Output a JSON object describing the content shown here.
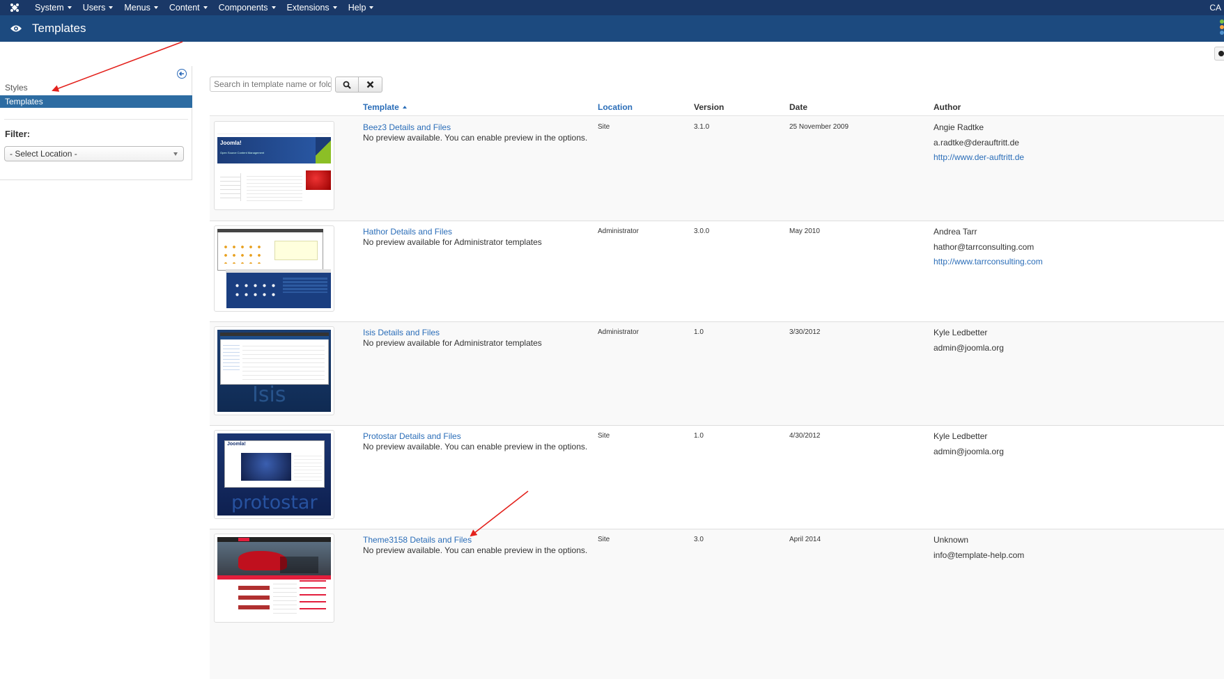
{
  "navbar": {
    "menus": [
      "System",
      "Users",
      "Menus",
      "Content",
      "Components",
      "Extensions",
      "Help"
    ],
    "right_text": "CA"
  },
  "header": {
    "title": "Templates"
  },
  "sidebar": {
    "items": [
      {
        "label": "Styles",
        "active": false
      },
      {
        "label": "Templates",
        "active": true
      }
    ],
    "filter_label": "Filter:",
    "location_select": "- Select Location -"
  },
  "search": {
    "placeholder": "Search in template name or folder"
  },
  "table": {
    "headers": {
      "template": "Template",
      "location": "Location",
      "version": "Version",
      "date": "Date",
      "author": "Author"
    },
    "rows": [
      {
        "name": "Beez3 Details and Files",
        "desc": "No preview available. You can enable preview in the options.",
        "location": "Site",
        "version": "3.1.0",
        "date": "25 November 2009",
        "author": "Angie Radtke",
        "email": "a.radtke@derauftritt.de",
        "url": "http://www.der-auftritt.de",
        "thumb": "beez3"
      },
      {
        "name": "Hathor Details and Files",
        "desc": "No preview available for Administrator templates",
        "location": "Administrator",
        "version": "3.0.0",
        "date": "May 2010",
        "author": "Andrea Tarr",
        "email": "hathor@tarrconsulting.com",
        "url": "http://www.tarrconsulting.com",
        "thumb": "hathor"
      },
      {
        "name": "Isis Details and Files",
        "desc": "No preview available for Administrator templates",
        "location": "Administrator",
        "version": "1.0",
        "date": "3/30/2012",
        "author": "Kyle Ledbetter",
        "email": "admin@joomla.org",
        "url": "",
        "thumb": "isis"
      },
      {
        "name": "Protostar Details and Files",
        "desc": "No preview available. You can enable preview in the options.",
        "location": "Site",
        "version": "1.0",
        "date": "4/30/2012",
        "author": "Kyle Ledbetter",
        "email": "admin@joomla.org",
        "url": "",
        "thumb": "protostar"
      },
      {
        "name": "Theme3158 Details and Files",
        "desc": "No preview available. You can enable preview in the options.",
        "location": "Site",
        "version": "3.0",
        "date": "April 2014",
        "author": "Unknown",
        "email": "info@template-help.com",
        "url": "",
        "thumb": "theme3158"
      }
    ]
  },
  "thumbnails": {
    "beez3": {
      "brand": "Joomla!",
      "tagline": "Open Source Content Management"
    },
    "isis": {
      "label": "Isis"
    },
    "protostar": {
      "label": "protostar",
      "brand": "Joomla!"
    }
  },
  "colors": {
    "navbar": "#1a3867",
    "header": "#1c4a7f",
    "link": "#2a6db8",
    "sidebar_active": "#2d6ca2",
    "annotation_arrow": "#e3211c"
  }
}
